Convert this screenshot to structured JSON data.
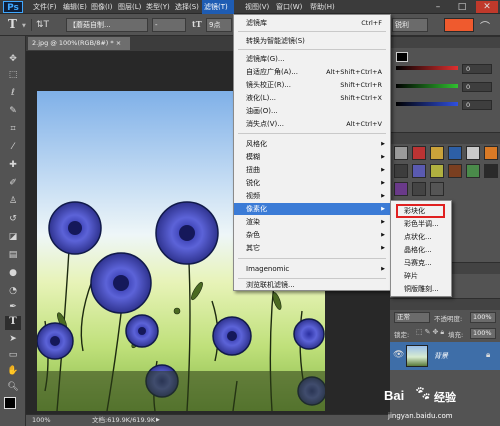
{
  "app": {
    "logo": "Ps"
  },
  "menubar": {
    "items": [
      "文件(F)",
      "编辑(E)",
      "图像(I)",
      "图层(L)",
      "类型(Y)",
      "选择(S)",
      "滤镜(T)",
      "视图(V)",
      "窗口(W)",
      "帮助(H)"
    ],
    "active_index": 6,
    "window_controls": [
      "–",
      "□",
      "✕"
    ]
  },
  "options_bar": {
    "tool_glyph": "T",
    "font_family": "【蘑菇自制...",
    "font_style": "-",
    "font_size": "9点",
    "aa_mode": "锐利"
  },
  "document": {
    "tab_title": "2.jpg @ 100%(RGB/8#) * ×",
    "zoom": "100%",
    "doc_info": "文档:619.9K/619.9K"
  },
  "filter_menu": {
    "items": [
      {
        "label": "滤镜库",
        "shortcut": "Ctrl+F",
        "submenu": false
      },
      {
        "label": "转换为智能滤镜(S)",
        "shortcut": "",
        "submenu": false
      },
      {
        "label": "滤镜库(G)...",
        "shortcut": "",
        "submenu": false
      },
      {
        "label": "自适应广角(A)...",
        "shortcut": "Alt+Shift+Ctrl+A",
        "submenu": false
      },
      {
        "label": "镜头校正(R)...",
        "shortcut": "Shift+Ctrl+R",
        "submenu": false
      },
      {
        "label": "液化(L)...",
        "shortcut": "Shift+Ctrl+X",
        "submenu": false
      },
      {
        "label": "油画(O)...",
        "shortcut": "",
        "submenu": false
      },
      {
        "label": "消失点(V)...",
        "shortcut": "Alt+Ctrl+V",
        "submenu": false
      },
      {
        "label": "风格化",
        "shortcut": "",
        "submenu": true
      },
      {
        "label": "模糊",
        "shortcut": "",
        "submenu": true
      },
      {
        "label": "扭曲",
        "shortcut": "",
        "submenu": true
      },
      {
        "label": "锐化",
        "shortcut": "",
        "submenu": true
      },
      {
        "label": "视频",
        "shortcut": "",
        "submenu": true
      },
      {
        "label": "像素化",
        "shortcut": "",
        "submenu": true
      },
      {
        "label": "渲染",
        "shortcut": "",
        "submenu": true
      },
      {
        "label": "杂色",
        "shortcut": "",
        "submenu": true
      },
      {
        "label": "其它",
        "shortcut": "",
        "submenu": true
      },
      {
        "label": "Imagenomic",
        "shortcut": "",
        "submenu": true
      },
      {
        "label": "浏览联机滤镜...",
        "shortcut": "",
        "submenu": false
      }
    ],
    "highlighted_index": 13
  },
  "pixelate_submenu": {
    "items": [
      "彩块化",
      "彩色半调...",
      "点状化...",
      "晶格化...",
      "马赛克...",
      "碎片",
      "铜版雕刻..."
    ],
    "boxed_index": 0
  },
  "color_panel": {
    "values": [
      "0",
      "0",
      "0"
    ],
    "colors": [
      "#e03030",
      "#30c030",
      "#3050e0"
    ]
  },
  "layers_panel": {
    "blend_mode": "正常",
    "opacity_label": "不透明度:",
    "opacity_value": "100%",
    "lock_label": "锁定:",
    "fill_label": "填充:",
    "fill_value": "100%",
    "layer_name": "背景"
  },
  "watermark": {
    "brand": "Bai",
    "brand_cn": "经验",
    "url": "jingyan.baidu.com"
  }
}
